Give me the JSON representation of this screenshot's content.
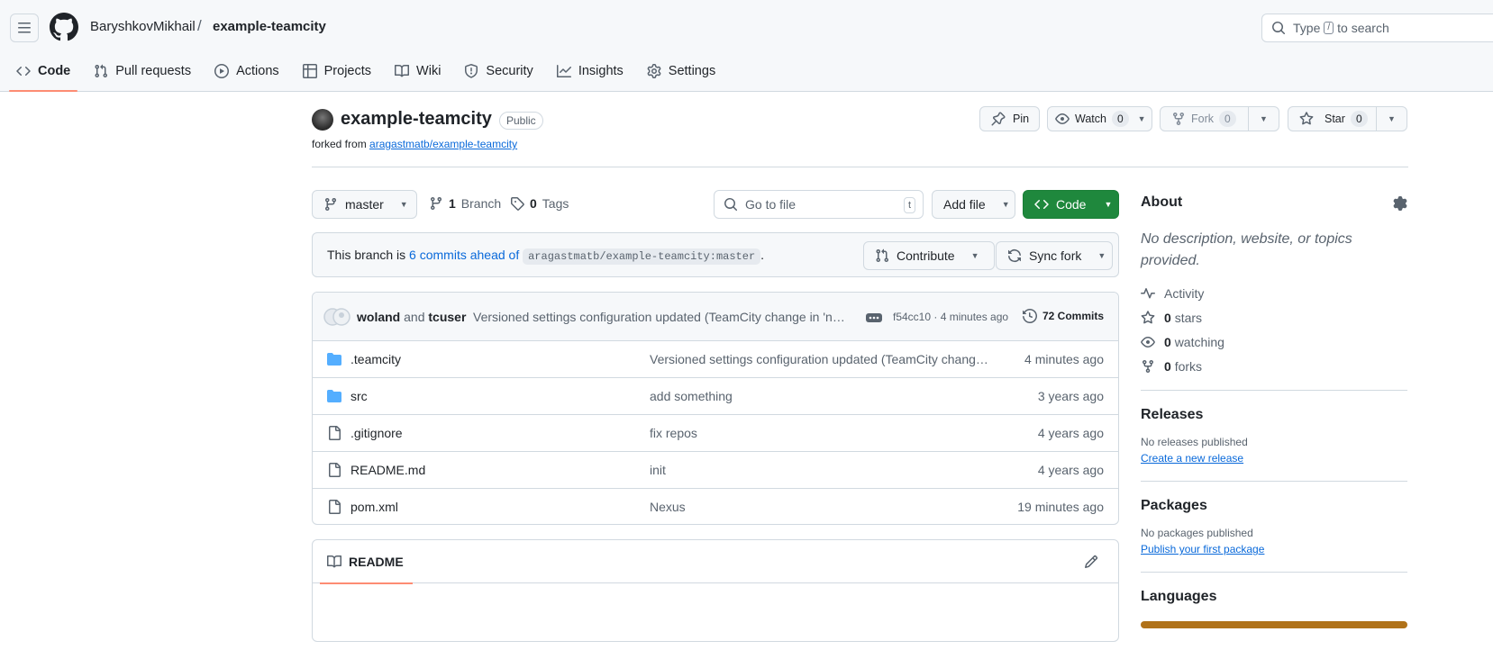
{
  "header": {
    "owner": "BaryshkovMikhail",
    "separator": "/",
    "repo": "example-teamcity",
    "search_prefix": "Type",
    "search_key": "/",
    "search_suffix": "to search"
  },
  "tabs": [
    {
      "label": "Code",
      "icon": "code-icon",
      "active": true
    },
    {
      "label": "Pull requests",
      "icon": "pull-request-icon"
    },
    {
      "label": "Actions",
      "icon": "play-icon"
    },
    {
      "label": "Projects",
      "icon": "table-icon"
    },
    {
      "label": "Wiki",
      "icon": "book-icon"
    },
    {
      "label": "Security",
      "icon": "shield-icon"
    },
    {
      "label": "Insights",
      "icon": "graph-icon"
    },
    {
      "label": "Settings",
      "icon": "gear-icon"
    }
  ],
  "repo": {
    "name": "example-teamcity",
    "visibility": "Public",
    "forked_prefix": "forked from",
    "forked_from": "aragastmatb/example-teamcity"
  },
  "actions": {
    "pin": "Pin",
    "watch": "Watch",
    "watch_count": "0",
    "fork": "Fork",
    "fork_count": "0",
    "star": "Star",
    "star_count": "0"
  },
  "toolbar": {
    "branch": "master",
    "branch_count": "1",
    "branch_label": "Branch",
    "tag_count": "0",
    "tag_label": "Tags",
    "goto_placeholder": "Go to file",
    "goto_key": "t",
    "add_file": "Add file",
    "code": "Code"
  },
  "ahead": {
    "prefix": "This branch is",
    "link": "6 commits ahead of",
    "ref": "aragastmatb/example-teamcity:master",
    "suffix": ".",
    "contribute": "Contribute",
    "sync": "Sync fork"
  },
  "commit": {
    "author1": "woland",
    "and": "and",
    "author2": "tcuser",
    "message": "Versioned settings configuration updated (TeamCity change in 'ne…",
    "sha_time": "f54cc10 · 4 minutes ago",
    "count": "72 Commits"
  },
  "files": [
    {
      "type": "folder",
      "name": ".teamcity",
      "commit": "Versioned settings configuration updated (TeamCity chang…",
      "time": "4 minutes ago"
    },
    {
      "type": "folder",
      "name": "src",
      "commit": "add something",
      "time": "3 years ago"
    },
    {
      "type": "file",
      "name": ".gitignore",
      "commit": "fix repos",
      "time": "4 years ago"
    },
    {
      "type": "file",
      "name": "README.md",
      "commit": "init",
      "time": "4 years ago"
    },
    {
      "type": "file",
      "name": "pom.xml",
      "commit": "Nexus",
      "time": "19 minutes ago"
    }
  ],
  "readme": {
    "label": "README"
  },
  "sidebar": {
    "about_title": "About",
    "about_desc": "No description, website, or topics provided.",
    "activity": "Activity",
    "stars_count": "0",
    "stars_label": "stars",
    "watching_count": "0",
    "watching_label": "watching",
    "forks_count": "0",
    "forks_label": "forks",
    "releases_title": "Releases",
    "releases_none": "No releases published",
    "releases_link": "Create a new release",
    "packages_title": "Packages",
    "packages_none": "No packages published",
    "packages_link": "Publish your first package",
    "languages_title": "Languages"
  },
  "colors": {
    "accent_tab": "#fd8c73",
    "code_button": "#1f883d",
    "link": "#0969da",
    "java_lang": "#b07219"
  }
}
